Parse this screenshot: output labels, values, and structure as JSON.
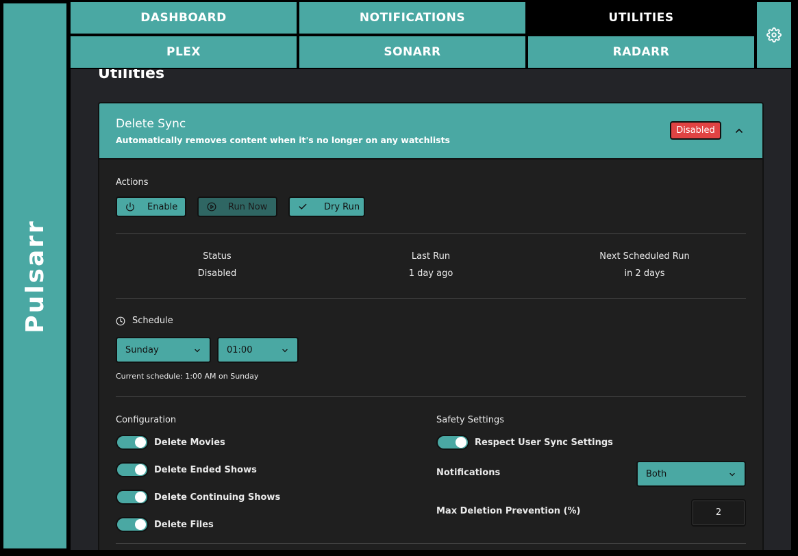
{
  "app": {
    "name": "Pulsarr"
  },
  "nav": {
    "row1": [
      "DASHBOARD",
      "NOTIFICATIONS",
      "UTILITIES"
    ],
    "row2": [
      "PLEX",
      "SONARR",
      "RADARR"
    ],
    "active": "UTILITIES"
  },
  "page": {
    "title": "Utilities"
  },
  "card": {
    "title": "Delete Sync",
    "subtitle": "Automatically removes content when it's no longer on any watchlists",
    "badge": "Disabled",
    "colors": {
      "accent": "#4aa8a3",
      "badge": "#e04343",
      "panel": "#1f1f1f",
      "background": "#232428"
    }
  },
  "actions": {
    "label": "Actions",
    "buttons": [
      {
        "label": "Enable",
        "icon": "power-icon"
      },
      {
        "label": "Run Now",
        "icon": "play-circle-icon"
      },
      {
        "label": "Dry Run",
        "icon": "check-icon"
      }
    ]
  },
  "status": {
    "items": [
      {
        "label": "Status",
        "value": "Disabled"
      },
      {
        "label": "Last Run",
        "value": "1 day ago"
      },
      {
        "label": "Next Scheduled Run",
        "value": "in 2 days"
      }
    ]
  },
  "schedule": {
    "label": "Schedule",
    "day": "Sunday",
    "time": "01:00",
    "note": "Current schedule: 1:00 AM on Sunday"
  },
  "configuration": {
    "label": "Configuration",
    "toggles": [
      {
        "label": "Delete Movies",
        "on": true
      },
      {
        "label": "Delete Ended Shows",
        "on": true
      },
      {
        "label": "Delete Continuing Shows",
        "on": true
      },
      {
        "label": "Delete Files",
        "on": true
      }
    ]
  },
  "safety": {
    "label": "Safety Settings",
    "respect_label": "Respect User Sync Settings",
    "notifications_label": "Notifications",
    "notifications_value": "Both",
    "max_label": "Max Deletion Prevention (%)",
    "max_value": "2"
  }
}
